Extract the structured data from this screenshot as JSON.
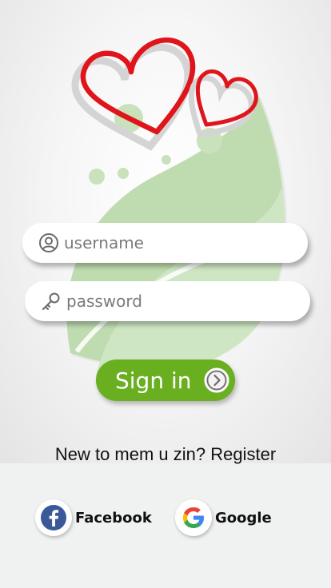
{
  "login": {
    "username_placeholder": "username",
    "password_placeholder": "password",
    "signin_label": "Sign in"
  },
  "register": {
    "prompt": "New to mem u zin?",
    "link": "Register"
  },
  "social": {
    "facebook_label": "Facebook",
    "google_label": "Google"
  },
  "colors": {
    "accent_green": "#6aaf1f",
    "heart_red": "#e0141b",
    "leaf_green": "#bfdcb0",
    "facebook_blue": "#3b5998"
  },
  "icons": {
    "username": "user-circle-icon",
    "password": "key-icon",
    "signin": "chevron-right-circle-icon",
    "facebook": "facebook-icon",
    "google": "google-icon"
  }
}
